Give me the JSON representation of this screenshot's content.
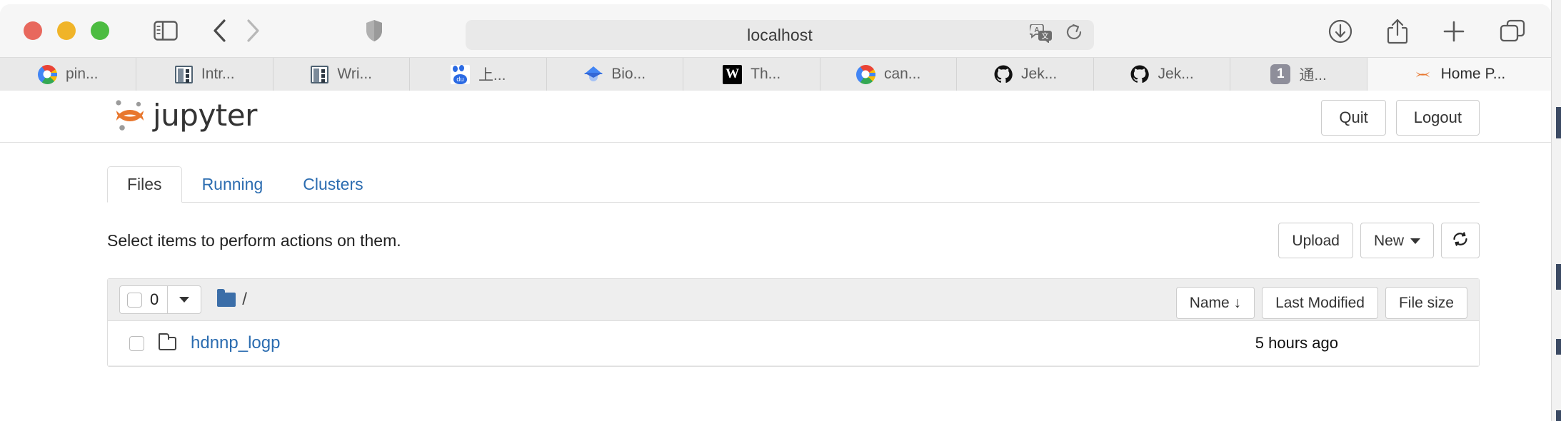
{
  "browser": {
    "window_controls": [
      {
        "name": "close",
        "color": "#e8685d"
      },
      {
        "name": "minimize",
        "color": "#f0b429"
      },
      {
        "name": "maximize",
        "color": "#4cbc41"
      }
    ],
    "sidebar_toggle": "sidebar-icon",
    "back": "chevron-left-icon",
    "forward": "chevron-right-icon",
    "shield": "shield-icon",
    "address": {
      "url": "localhost",
      "translate_icon": "translate-icon",
      "reload_icon": "reload-icon"
    },
    "right_icons": [
      {
        "name": "downloads-icon"
      },
      {
        "name": "share-icon"
      },
      {
        "name": "new-tab-icon"
      },
      {
        "name": "tab-overview-icon"
      }
    ],
    "tabs": [
      {
        "label": "pin...",
        "favicon": "google-icon",
        "active": false
      },
      {
        "label": "Intr...",
        "favicon": "document-icon",
        "active": false
      },
      {
        "label": "Wri...",
        "favicon": "document-icon",
        "active": false
      },
      {
        "label": "上...",
        "favicon": "baidu-icon",
        "active": false
      },
      {
        "label": "Bio...",
        "favicon": "google-scholar-icon",
        "active": false
      },
      {
        "label": "Th...",
        "favicon": "wikipedia-w-icon",
        "active": false
      },
      {
        "label": "can...",
        "favicon": "google-icon",
        "active": false
      },
      {
        "label": "Jek...",
        "favicon": "github-icon",
        "active": false
      },
      {
        "label": "Jek...",
        "favicon": "github-icon",
        "active": false
      },
      {
        "label": "通...",
        "favicon": "badge-1",
        "badge": "1",
        "active": false
      },
      {
        "label": "Home P...",
        "favicon": "jupyter-icon",
        "active": true
      }
    ]
  },
  "jupyter": {
    "brand": "jupyter",
    "header_buttons": [
      {
        "label": "Quit"
      },
      {
        "label": "Logout"
      }
    ],
    "nav_tabs": [
      {
        "label": "Files",
        "active": true
      },
      {
        "label": "Running",
        "active": false
      },
      {
        "label": "Clusters",
        "active": false
      }
    ],
    "action_hint": "Select items to perform actions on them.",
    "action_buttons": [
      {
        "label": "Upload"
      },
      {
        "label": "New"
      }
    ],
    "refresh_icon": "refresh-icon",
    "list_header": {
      "select_count": "0",
      "breadcrumb": "/",
      "folder_icon": "folder-icon",
      "sort_buttons": [
        {
          "label": "Name ↓"
        },
        {
          "label": "Last Modified"
        },
        {
          "label": "File size"
        }
      ]
    },
    "rows": [
      {
        "name": "hdnnp_logp",
        "icon": "folder-outline-icon",
        "modified": "5 hours ago",
        "size": ""
      }
    ]
  },
  "colors": {
    "accent_blue": "#2b6cb0",
    "jupyter_orange": "#e8772e",
    "toolbar_bg": "#f6f6f6",
    "tabstrip_bg": "#e9e9e9"
  }
}
